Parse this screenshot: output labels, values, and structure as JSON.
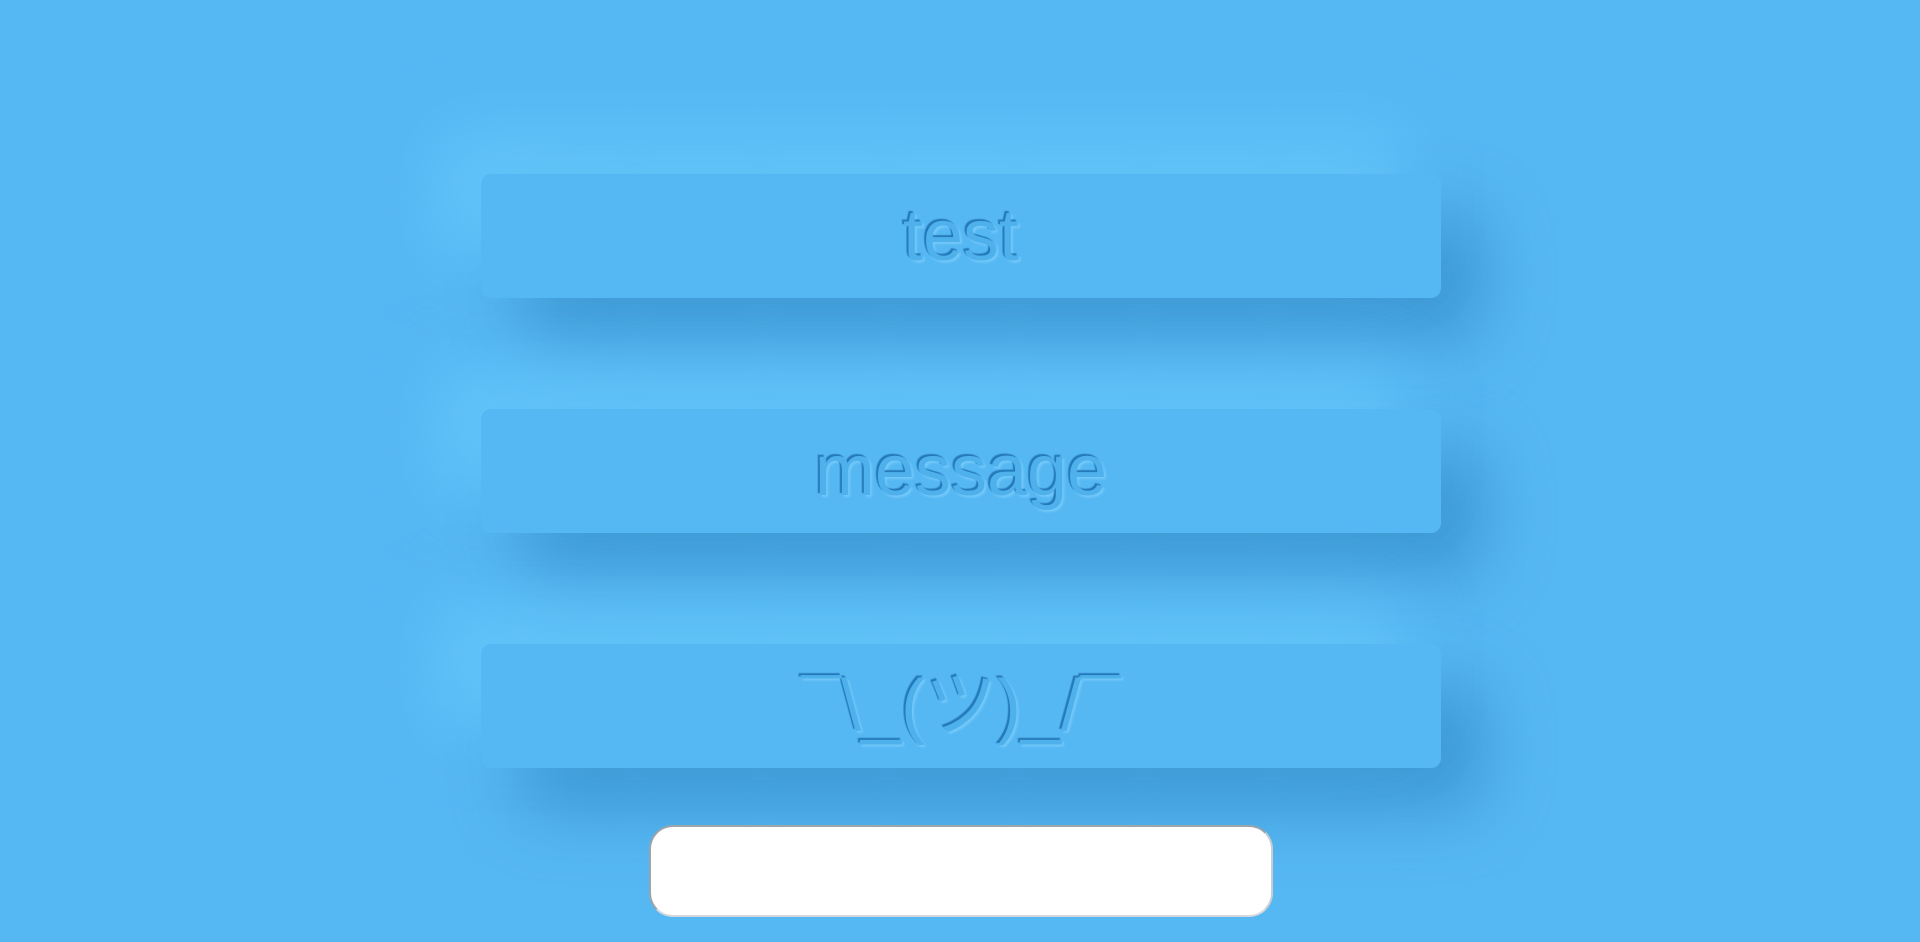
{
  "cards": [
    {
      "text": "test"
    },
    {
      "text": "message"
    },
    {
      "text": "¯\\_(ツ)_/¯"
    }
  ],
  "input": {
    "value": "",
    "placeholder": ""
  },
  "colors": {
    "background": "#56b8f3",
    "card_text": "#4fb1ec",
    "input_background": "#ffffff"
  }
}
